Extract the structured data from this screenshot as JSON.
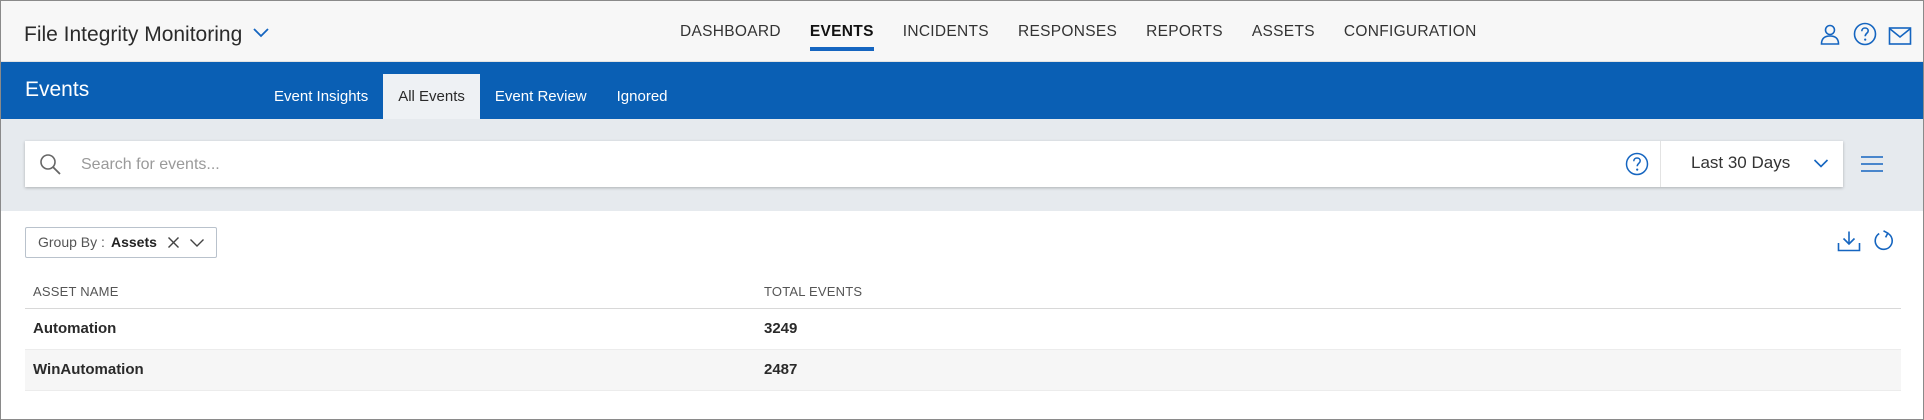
{
  "header": {
    "app_title": "File Integrity Monitoring",
    "nav": [
      {
        "label": "DASHBOARD",
        "active": false
      },
      {
        "label": "EVENTS",
        "active": true
      },
      {
        "label": "INCIDENTS",
        "active": false
      },
      {
        "label": "RESPONSES",
        "active": false
      },
      {
        "label": "REPORTS",
        "active": false
      },
      {
        "label": "ASSETS",
        "active": false
      },
      {
        "label": "CONFIGURATION",
        "active": false
      }
    ],
    "icons": [
      "user-icon",
      "help-icon",
      "mail-icon"
    ]
  },
  "subheader": {
    "title": "Events",
    "tabs": [
      {
        "label": "Event Insights",
        "active": false
      },
      {
        "label": "All Events",
        "active": true
      },
      {
        "label": "Event Review",
        "active": false
      },
      {
        "label": "Ignored",
        "active": false
      }
    ]
  },
  "search": {
    "placeholder": "Search for events...",
    "value": "",
    "time_range": "Last 30 Days"
  },
  "toolbar": {
    "group_by_label": "Group By :",
    "group_by_value": "Assets"
  },
  "table": {
    "columns": [
      "ASSET NAME",
      "TOTAL EVENTS"
    ],
    "rows": [
      {
        "asset_name": "Automation",
        "total_events": "3249"
      },
      {
        "asset_name": "WinAutomation",
        "total_events": "2487"
      }
    ]
  },
  "colors": {
    "brand_blue": "#0a5fb4",
    "active_underline": "#1565c0",
    "icon_blue": "#1565c0"
  }
}
